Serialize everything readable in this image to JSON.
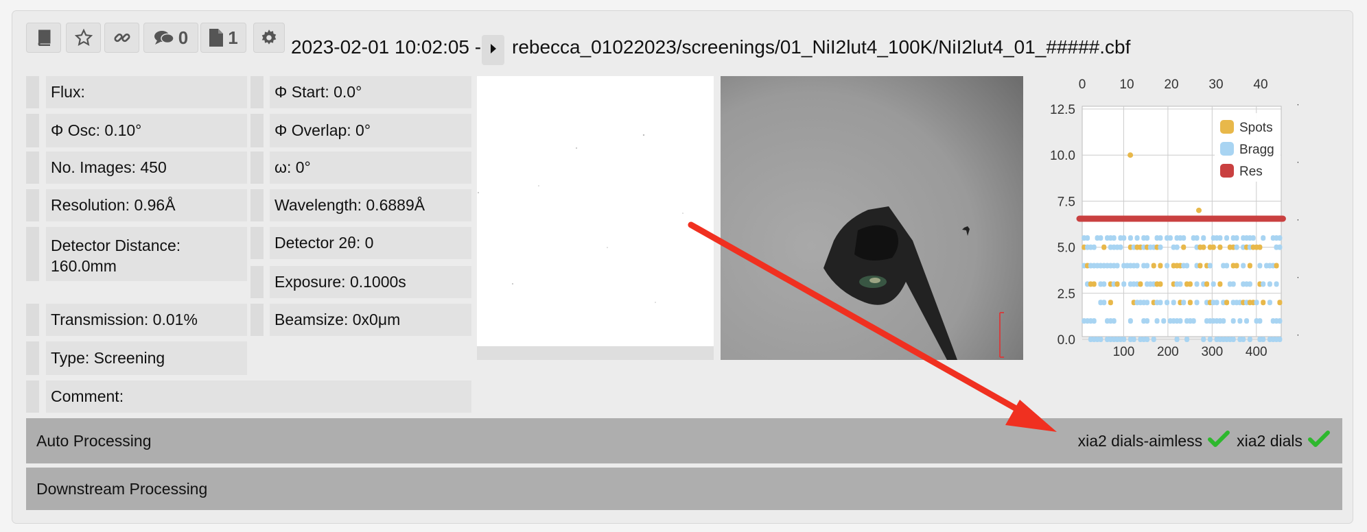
{
  "toolbar": {
    "comments_count": "0",
    "attachments_count": "1",
    "title_prefix": "2023-02-01 10:02:05 -",
    "title_path": "rebecca_01022023/screenings/01_NiI2lut4_100K/NiI2lut4_01_#####.cbf"
  },
  "params": {
    "flux": "Flux:",
    "osc": "Φ Osc: 0.10°",
    "images": "No. Images: 450",
    "resolution": "Resolution: 0.96Å",
    "distance": "Detector Distance: 160.0mm",
    "transmission": "Transmission: 0.01%",
    "type": "Type: Screening",
    "comment": "Comment:",
    "phi_start": "Φ Start: 0.0°",
    "overlap": "Φ Overlap: 0°",
    "omega": "ω: 0°",
    "wavelength": "Wavelength: 0.6889Å",
    "two_theta": "Detector 2θ: 0",
    "exposure": "Exposure: 0.1000s",
    "beamsize": "Beamsize: 0x0μm"
  },
  "sections": {
    "auto_processing": "Auto Processing",
    "downstream_processing": "Downstream Processing",
    "auto_status": [
      {
        "label": "xia2 dials-aimless",
        "status": "success"
      },
      {
        "label": "xia2 dials",
        "status": "success"
      }
    ]
  },
  "colors": {
    "spots": "#e8b84a",
    "bragg": "#a8d4f2",
    "res": "#c94040",
    "success": "#2eb82e",
    "annotation_arrow": "#f03020"
  },
  "chart_data": {
    "type": "scatter",
    "x_bottom_ticks": [
      "100",
      "200",
      "300",
      "400"
    ],
    "x_top_ticks": [
      "0",
      "10",
      "20",
      "30",
      "40"
    ],
    "y_left_ticks": [
      "0.0",
      "2.5",
      "5.0",
      "7.5",
      "10.0",
      "12.5"
    ],
    "y_right_ticks": [
      "-0.990",
      "-0.995",
      "-1.000",
      "-1.005",
      "-1.010"
    ],
    "xlim_bottom": [
      0,
      450
    ],
    "ylim_left": [
      0,
      12.5
    ],
    "ylim_right": [
      -0.99,
      -1.01
    ],
    "legend": [
      "Spots",
      "Bragg",
      "Res"
    ],
    "legend_position": "top-right",
    "grid": true,
    "series": [
      {
        "name": "Spots",
        "x": [
          115,
          270
        ],
        "y": [
          10,
          7
        ]
      },
      {
        "name": "Res",
        "x": [
          0,
          460
        ],
        "y": [
          -1.0,
          -1.0
        ]
      }
    ]
  }
}
